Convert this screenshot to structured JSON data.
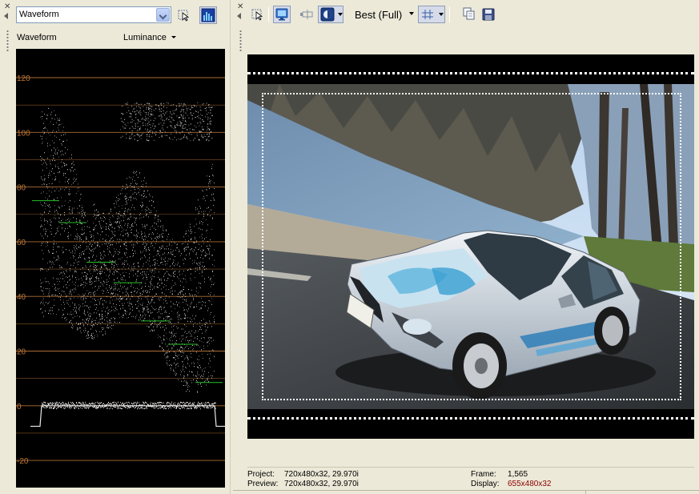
{
  "scopes_pane": {
    "scope_type": "Waveform",
    "scope_label": "Waveform",
    "mode": "Luminance",
    "y_axis_ticks": [
      "120",
      "100",
      "80",
      "60",
      "40",
      "20",
      "0",
      "-20"
    ],
    "graticule_color": "#c07838",
    "trace_color": "#e8e8e8",
    "marker_color": "#28c028"
  },
  "preview_pane": {
    "quality": "Best (Full)",
    "info": {
      "project_label": "Project:",
      "project_value": "720x480x32, 29.970i",
      "preview_label": "Preview:",
      "preview_value": "720x480x32, 29.970i",
      "frame_label": "Frame:",
      "frame_value": "1,565",
      "display_label": "Display:",
      "display_value": "655x480x32",
      "display_value_color": "#8b0000"
    }
  }
}
